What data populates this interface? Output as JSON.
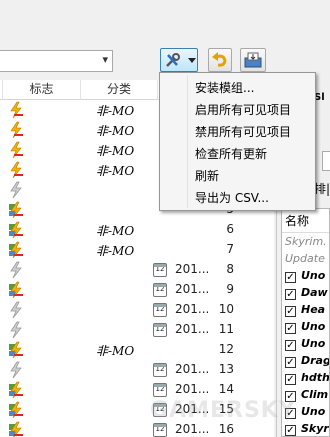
{
  "toolbar": {
    "category_dropdown_value": "",
    "tools_button": "tools-icon",
    "undo_button": "undo-icon",
    "save_button": "save-icon"
  },
  "table": {
    "columns": [
      "标志",
      "分类"
    ],
    "rows": [
      {
        "flag": "lightning-red",
        "category": "非-MO",
        "date": "",
        "number": ""
      },
      {
        "flag": "lightning-red",
        "category": "非-MO",
        "date": "",
        "number": ""
      },
      {
        "flag": "lightning-red",
        "category": "非-MO",
        "date": "",
        "number": ""
      },
      {
        "flag": "lightning-red",
        "category": "非-MO",
        "date": "",
        "number": ""
      },
      {
        "flag": "lightning-gray",
        "category": "",
        "date": "",
        "number": ""
      },
      {
        "flag": "lightning-red-puzzle",
        "category": "",
        "date": "",
        "number": "5"
      },
      {
        "flag": "lightning-red-puzzle",
        "category": "非-MO",
        "date": "",
        "number": "6"
      },
      {
        "flag": "lightning-red-puzzle",
        "category": "非-MO",
        "date": "",
        "number": "7"
      },
      {
        "flag": "lightning-gray",
        "category": "",
        "date": "201...",
        "number": "8"
      },
      {
        "flag": "lightning-red-puzzle",
        "category": "",
        "date": "201...",
        "number": "9"
      },
      {
        "flag": "lightning-gray",
        "category": "",
        "date": "201...",
        "number": "10"
      },
      {
        "flag": "lightning-gray",
        "category": "",
        "date": "201...",
        "number": "11"
      },
      {
        "flag": "lightning-red-puzzle",
        "category": "非-MO",
        "date": "",
        "number": "12"
      },
      {
        "flag": "lightning-gray",
        "category": "",
        "date": "201...",
        "number": "13"
      },
      {
        "flag": "lightning-red-puzzle",
        "category": "",
        "date": "201...",
        "number": "14"
      },
      {
        "flag": "lightning-red-puzzle",
        "category": "",
        "date": "201...",
        "number": "15"
      },
      {
        "flag": "lightning-red-puzzle",
        "category": "",
        "date": "201...",
        "number": "16"
      }
    ]
  },
  "right_panel": {
    "tab_label": "Sl",
    "label2": "排|",
    "list_header": "名称",
    "items": [
      {
        "text": "Skyrim.",
        "checked": false,
        "style": "plain"
      },
      {
        "text": "Update",
        "checked": false,
        "style": "plain"
      },
      {
        "text": "Uno",
        "checked": true
      },
      {
        "text": "Daw",
        "checked": true
      },
      {
        "text": "Hea",
        "checked": true
      },
      {
        "text": "Uno",
        "checked": true
      },
      {
        "text": "Uno",
        "checked": true
      },
      {
        "text": "Drag",
        "checked": true
      },
      {
        "text": "hdth",
        "checked": true
      },
      {
        "text": "Clim",
        "checked": true
      },
      {
        "text": "Uno",
        "checked": true
      },
      {
        "text": "Skyr",
        "checked": true
      }
    ]
  },
  "context_menu": {
    "items": [
      "安装模组...",
      "启用所有可见项目",
      "禁用所有可见项目",
      "检查所有更新",
      "刷新",
      "导出为 CSV..."
    ]
  },
  "watermark": "GAMERSKY",
  "colors": {
    "menu_bg": "#f5f5f5",
    "tools_button_active": "#bee6fd",
    "flag_red": "#d42a1f",
    "flag_yellow": "#f2b400"
  }
}
